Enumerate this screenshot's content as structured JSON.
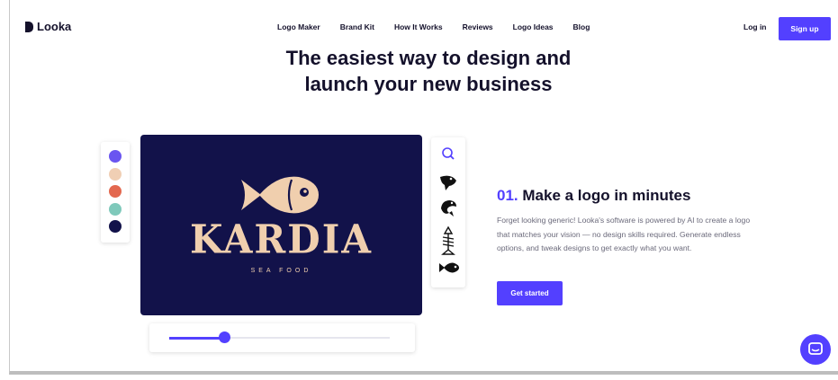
{
  "nav": {
    "brand": "Looka",
    "links": [
      "Logo Maker",
      "Brand Kit",
      "How It Works",
      "Reviews",
      "Logo Ideas",
      "Blog"
    ],
    "login": "Log in",
    "signup": "Sign up"
  },
  "hero": {
    "line1": "The easiest way to design and",
    "line2": "launch your new business"
  },
  "palette": {
    "colors": [
      "#6a55f0",
      "#f0cfb4",
      "#e3684f",
      "#7fc9bb",
      "#12124a"
    ]
  },
  "logo_preview": {
    "name": "KARDIA",
    "tagline": "SEA FOOD",
    "background": "#12124a",
    "foreground": "#f0cfae"
  },
  "icon_panel": {
    "icons": [
      "search-icon",
      "fish-head-icon",
      "fish-curled-icon",
      "fish-skeleton-icon",
      "fish-swim-icon"
    ]
  },
  "slider": {
    "value": 0.25
  },
  "feature": {
    "number": "01.",
    "title": "Make a logo in minutes",
    "description": "Forget looking generic! Looka's software is powered by AI to create a logo that matches your vision — no design skills required. Generate endless options, and tweak designs to get exactly what you want.",
    "cta": "Get started"
  },
  "colors": {
    "accent": "#5340ff",
    "text": "#14112b"
  }
}
